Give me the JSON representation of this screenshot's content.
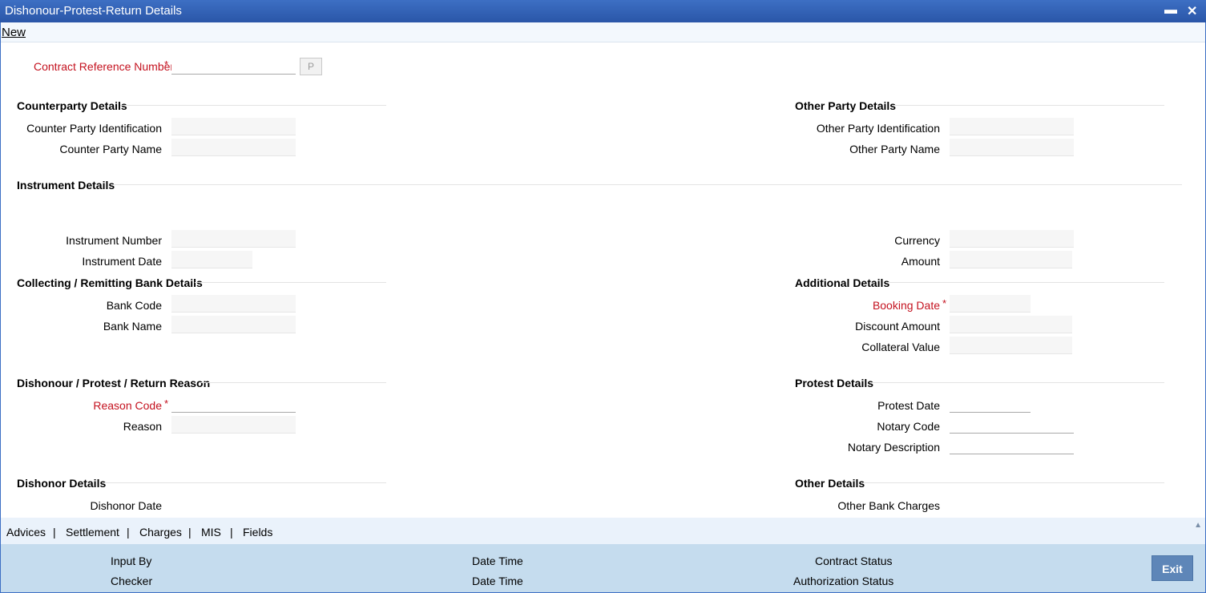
{
  "window": {
    "title": "Dishonour-Protest-Return Details",
    "minimize_icon": "▬",
    "close_icon": "✕"
  },
  "menu": {
    "new_label": "New"
  },
  "contract": {
    "ref_label": "Contract Reference Number",
    "required": "*",
    "pick_label": "P"
  },
  "counterparty": {
    "heading": "Counterparty Details",
    "id_label": "Counter Party Identification",
    "name_label": "Counter Party Name"
  },
  "other_party": {
    "heading": "Other Party Details",
    "id_label": "Other Party Identification",
    "name_label": "Other Party Name"
  },
  "instrument": {
    "heading": "Instrument Details",
    "number_label": "Instrument Number",
    "date_label": "Instrument Date",
    "currency_label": "Currency",
    "amount_label": "Amount"
  },
  "bank": {
    "heading": "Collecting / Remitting Bank Details",
    "code_label": "Bank Code",
    "name_label": "Bank Name"
  },
  "additional": {
    "heading": "Additional Details",
    "booking_label": "Booking Date",
    "discount_label": "Discount Amount",
    "collateral_label": "Collateral Value"
  },
  "reason": {
    "heading": "Dishonour / Protest / Return Reason",
    "code_label": "Reason Code",
    "reason_label": "Reason"
  },
  "protest": {
    "heading": "Protest Details",
    "date_label": "Protest Date",
    "notary_code_label": "Notary Code",
    "notary_desc_label": "Notary Description"
  },
  "dishonor": {
    "heading": "Dishonor Details",
    "date_label": "Dishonor Date"
  },
  "other_details": {
    "heading": "Other Details",
    "charges_label": "Other Bank Charges"
  },
  "tabs": [
    "Advices",
    "Settlement",
    "Charges",
    "MIS",
    "Fields"
  ],
  "tab_separator": "|",
  "footer": {
    "input_by": "Input By",
    "checker": "Checker",
    "date_time_1": "Date Time",
    "date_time_2": "Date Time",
    "contract_status": "Contract Status",
    "auth_status": "Authorization Status",
    "exit_label": "Exit"
  },
  "colors": {
    "titlebar": "#2a56a8",
    "required": "#c4121f",
    "footer": "#c5dcee",
    "exit_button": "#5e86b8"
  }
}
